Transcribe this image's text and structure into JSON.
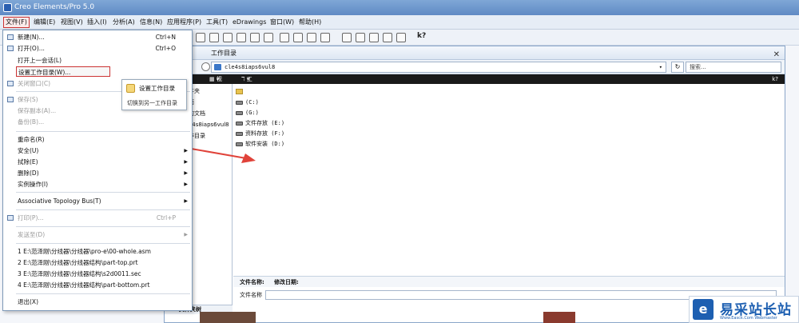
{
  "window": {
    "title": "Creo Elements/Pro 5.0"
  },
  "menubar": {
    "items": [
      "文件(F)",
      "编辑(E)",
      "视图(V)",
      "插入(I)",
      "分析(A)",
      "信息(N)",
      "应用程序(P)",
      "工具(T)",
      "eDrawings",
      "窗口(W)",
      "帮助(H)"
    ]
  },
  "toolbar": {
    "help_glyph": "k?"
  },
  "file_menu": {
    "items": [
      {
        "label": "新建(N)...",
        "shortcut": "Ctrl+N"
      },
      {
        "label": "打开(O)...",
        "shortcut": "Ctrl+O"
      },
      {
        "label": "打开上一会话(L)"
      },
      {
        "label": "设置工作目录(W)..."
      },
      {
        "label": "关闭窗口(C)"
      },
      {
        "label": "保存(S)"
      },
      {
        "label": "保存副本(A)..."
      },
      {
        "label": "备份(B)..."
      },
      {
        "label": "重命名(R)"
      },
      {
        "label": "安全(U)"
      },
      {
        "label": "拭除(E)"
      },
      {
        "label": "删除(D)"
      },
      {
        "label": "实例操作(I)"
      },
      {
        "label": "Associative Topology Bus(T)"
      },
      {
        "label": "打印(P)...",
        "shortcut": "Ctrl+P"
      },
      {
        "label": "发送至(D)"
      },
      {
        "label": "1 E:\\范泽刚\\分线器\\分线器\\pro-e\\00-whole.asm"
      },
      {
        "label": "2 E:\\范泽刚\\分线器\\分线器结构\\part-top.prt"
      },
      {
        "label": "3 E:\\范泽刚\\分线器\\分线器结构\\s2d0011.sec"
      },
      {
        "label": "4 E:\\范泽刚\\分线器\\分线器结构\\part-bottom.prt"
      },
      {
        "label": "退出(X)"
      }
    ]
  },
  "tooltip": {
    "title": "设置工作目录",
    "description": "切换到另一工作目录"
  },
  "dialog": {
    "title": "工作目录",
    "address": "cle4s8iaps6vul8",
    "search_placeholder": "搜索...",
    "toolbar": {
      "view": "视图",
      "tools": "工具"
    },
    "nav_items": [
      "件夹",
      "面",
      "的文档",
      "e4s8iaps6vul8",
      "作目录",
      "文件夹树"
    ],
    "files": [
      "(C:)",
      "(G:)",
      "文件存放 (E:)",
      "资料存放 (F:)",
      "软件安装 (D:)"
    ],
    "info": {
      "name_label": "文件名称:",
      "date_label": "修改日期:"
    },
    "filename_label": "文件名称"
  },
  "watermark": {
    "text": "易采站长站",
    "sub": "Www.Easck.Com  Webmaster"
  }
}
